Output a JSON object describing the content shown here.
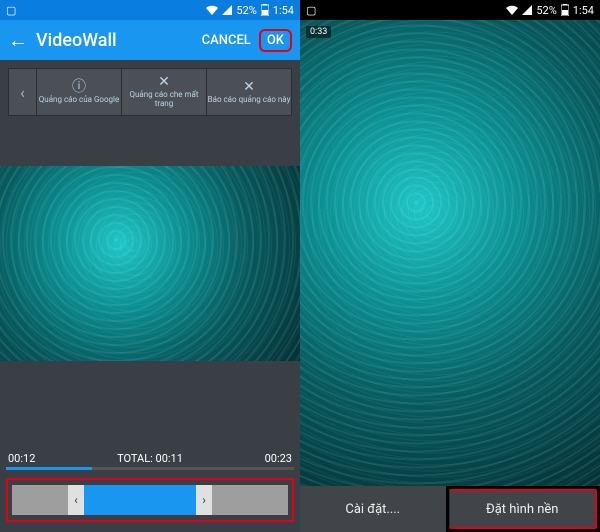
{
  "left": {
    "status": {
      "battery": "52%",
      "time": "1:54"
    },
    "title": "VideoWall",
    "actions": {
      "cancel": "CANCEL",
      "ok": "OK"
    },
    "ad": {
      "cell1": "Quảng cáo của Google",
      "cell2": "Quảng cáo che mất trang",
      "cell3": "Báo cáo quảng cáo này"
    },
    "times": {
      "start": "00:12",
      "total": "TOTAL: 00:11",
      "end": "00:23"
    }
  },
  "right": {
    "status": {
      "battery": "52%",
      "time": "1:54"
    },
    "timestamp": "0:33",
    "buttons": {
      "settings": "Cài đặt....",
      "setwall": "Đặt hình nền"
    }
  }
}
